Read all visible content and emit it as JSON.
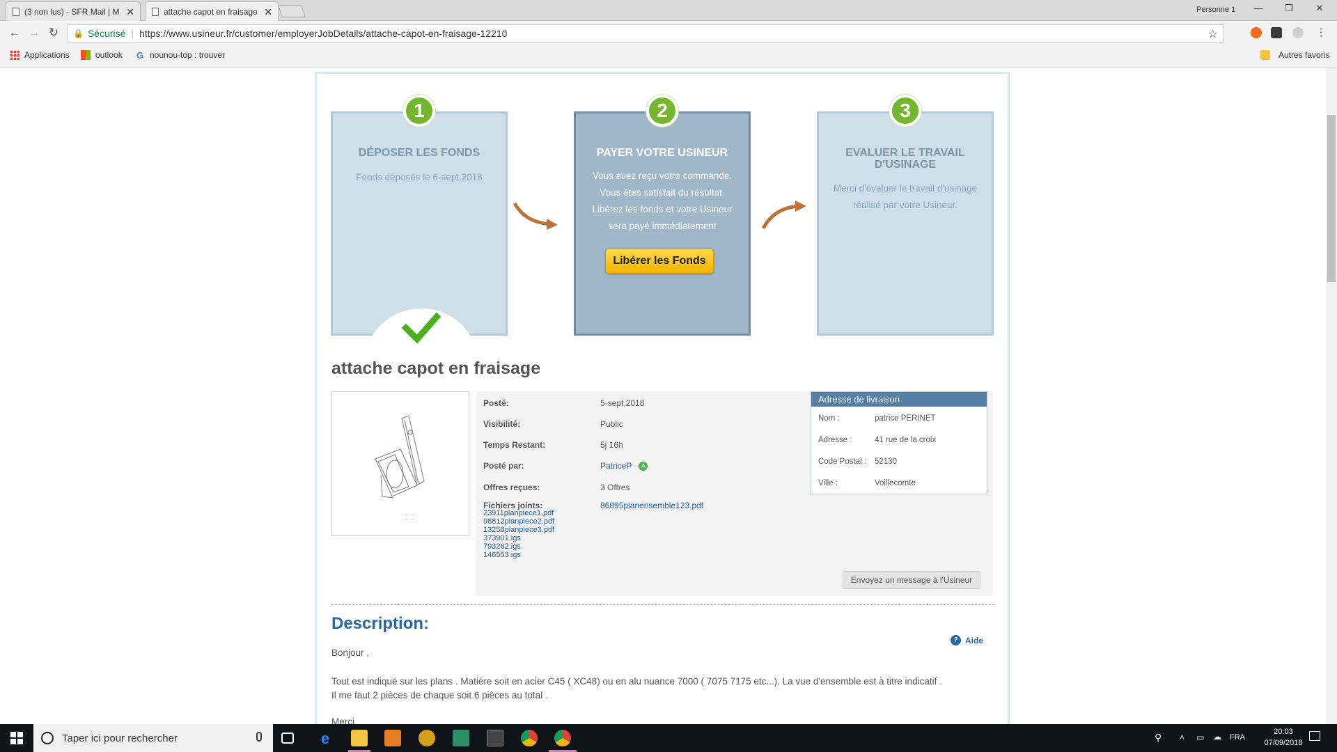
{
  "browser": {
    "tabs": [
      {
        "title": "(3 non lus) - SFR Mail | M",
        "active": false
      },
      {
        "title": "attache capot en fraisage",
        "active": true
      }
    ],
    "profile": "Personne 1",
    "security_label": "Sécurisé",
    "url": "https://www.usineur.fr/customer/employerJobDetails/attache-capot-en-fraisage-12210",
    "bookmarks": [
      "Applications",
      "outlook",
      "nounou-top : trouver"
    ],
    "other_bookmarks": "Autres favoris"
  },
  "steps": [
    {
      "number": "1",
      "title": "DÉPOSER LES FONDS",
      "text": "Fonds déposés le 6-sept,2018"
    },
    {
      "number": "2",
      "title": "PAYER VOTRE USINEUR",
      "lines": [
        "Vous avez reçu votre commande.",
        "Vous êtes satisfait du résultat.",
        "Libérez les fonds et votre Usineur",
        "sera payé immédiatement"
      ],
      "button": "Libérer les Fonds"
    },
    {
      "number": "3",
      "title_lines": [
        "EVALUER LE TRAVAIL",
        "D'USINAGE"
      ],
      "lines": [
        "Merci d'évaluer le travail d'usinage",
        "réalisé par votre Usineur."
      ]
    }
  ],
  "job": {
    "title": "attache capot en fraisage",
    "details": [
      {
        "label": "Posté:",
        "value": "5-sept,2018"
      },
      {
        "label": "Visibilité:",
        "value": "Public"
      },
      {
        "label": "Temps Restant:",
        "value": "5j 16h"
      },
      {
        "label": "Posté par:",
        "value": "PatriceP"
      },
      {
        "label": "Offres reçues:",
        "value": "3 Offres"
      }
    ],
    "files_label": "Fichiers joints:",
    "files": [
      "23911planpiece1.pdf",
      "98812planpiece2.pdf",
      "13258planpiece3.pdf",
      "373901.igs",
      "793262.igs",
      "146553.igs"
    ],
    "files_right": "86895planensemble123.pdf",
    "message_button": "Envoyez un message à l'Usineur"
  },
  "address": {
    "heading": "Adresse de livraison",
    "rows": [
      {
        "label": "Nom :",
        "value": "patrice PERINET"
      },
      {
        "label": "Adresse :",
        "value": "41 rue de la croix"
      },
      {
        "label": "Code Postal :",
        "value": "52130"
      },
      {
        "label": "Ville :",
        "value": "Voillecomte"
      }
    ]
  },
  "description": {
    "heading": "Description:",
    "help": "Aide",
    "lines": [
      "Bonjour ,",
      "Tout est indiqué sur les plans . Matière soit en acier C45 ( XC48) ou en alu nuance 7000 ( 7075 7175 etc...). La vue d'ensemble est à titre indicatif .",
      "Il me faut 2 pièces de chaque soit 6 pièces au total .",
      "Merci"
    ]
  },
  "taskbar": {
    "search_placeholder": "Taper ici pour rechercher",
    "lang": "FRA",
    "time": "20:03",
    "date": "07/09/2018"
  }
}
